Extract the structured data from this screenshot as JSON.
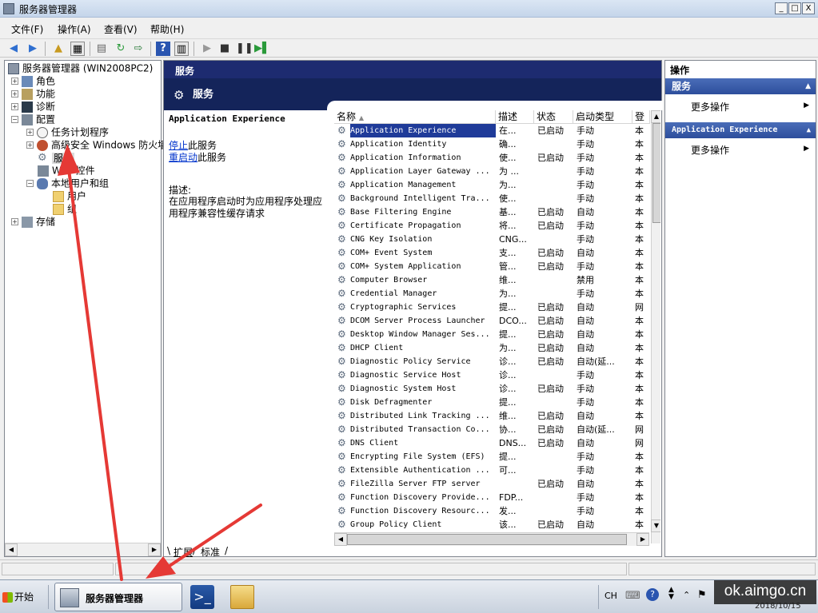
{
  "window": {
    "title": "服务器管理器",
    "controls": [
      "_",
      "□",
      "X"
    ]
  },
  "menu": [
    "文件(F)",
    "操作(A)",
    "查看(V)",
    "帮助(H)"
  ],
  "tree": {
    "root": "服务器管理器 (WIN2008PC2)",
    "roles": "角色",
    "features": "功能",
    "diagnostics": "诊断",
    "config": "配置",
    "task_scheduler": "任务计划程序",
    "firewall": "高级安全 Windows 防火墙",
    "services": "服务",
    "wmi": "WMI 控件",
    "local_users": "本地用户和组",
    "users": "用户",
    "groups": "组",
    "storage": "存储"
  },
  "center": {
    "header": "服务",
    "banner": "服务",
    "selected_service": "Application Experience",
    "stop_link": "停止",
    "stop_rest": "此服务",
    "restart_link": "重启动",
    "restart_rest": "此服务",
    "desc_label": "描述:",
    "desc_text": "在应用程序启动时为应用程序处理应用程序兼容性缓存请求",
    "tab_extended": "扩展",
    "tab_standard": "标准"
  },
  "list": {
    "columns": [
      "名称",
      "描述",
      "状态",
      "启动类型",
      "登"
    ],
    "rows": [
      [
        "Application Experience",
        "在...",
        "已启动",
        "手动",
        "本"
      ],
      [
        "Application Identity",
        "确...",
        "",
        "手动",
        "本"
      ],
      [
        "Application Information",
        "使...",
        "已启动",
        "手动",
        "本"
      ],
      [
        "Application Layer Gateway ...",
        "为 ...",
        "",
        "手动",
        "本"
      ],
      [
        "Application Management",
        "为...",
        "",
        "手动",
        "本"
      ],
      [
        "Background Intelligent Tra...",
        "使...",
        "",
        "手动",
        "本"
      ],
      [
        "Base Filtering Engine",
        "基...",
        "已启动",
        "自动",
        "本"
      ],
      [
        "Certificate Propagation",
        "将...",
        "已启动",
        "手动",
        "本"
      ],
      [
        "CNG Key Isolation",
        "CNG...",
        "",
        "手动",
        "本"
      ],
      [
        "COM+ Event System",
        "支...",
        "已启动",
        "自动",
        "本"
      ],
      [
        "COM+ System Application",
        "管...",
        "已启动",
        "手动",
        "本"
      ],
      [
        "Computer Browser",
        "维...",
        "",
        "禁用",
        "本"
      ],
      [
        "Credential Manager",
        "为...",
        "",
        "手动",
        "本"
      ],
      [
        "Cryptographic Services",
        "提...",
        "已启动",
        "自动",
        "网"
      ],
      [
        "DCOM Server Process Launcher",
        "DCO...",
        "已启动",
        "自动",
        "本"
      ],
      [
        "Desktop Window Manager Ses...",
        "提...",
        "已启动",
        "自动",
        "本"
      ],
      [
        "DHCP Client",
        "为...",
        "已启动",
        "自动",
        "本"
      ],
      [
        "Diagnostic Policy Service",
        "诊...",
        "已启动",
        "自动(延...",
        "本"
      ],
      [
        "Diagnostic Service Host",
        "诊...",
        "",
        "手动",
        "本"
      ],
      [
        "Diagnostic System Host",
        "诊...",
        "已启动",
        "手动",
        "本"
      ],
      [
        "Disk Defragmenter",
        "提...",
        "",
        "手动",
        "本"
      ],
      [
        "Distributed Link Tracking ...",
        "维...",
        "已启动",
        "自动",
        "本"
      ],
      [
        "Distributed Transaction Co...",
        "协...",
        "已启动",
        "自动(延...",
        "网"
      ],
      [
        "DNS Client",
        "DNS...",
        "已启动",
        "自动",
        "网"
      ],
      [
        "Encrypting File System (EFS)",
        "提...",
        "",
        "手动",
        "本"
      ],
      [
        "Extensible Authentication ...",
        "可...",
        "",
        "手动",
        "本"
      ],
      [
        "FileZilla Server FTP server",
        "",
        "已启动",
        "自动",
        "本"
      ],
      [
        "Function Discovery Provide...",
        "FDP...",
        "",
        "手动",
        "本"
      ],
      [
        "Function Discovery Resourc...",
        "发...",
        "",
        "手动",
        "本"
      ],
      [
        "Group Policy Client",
        "该...",
        "已启动",
        "自动",
        "本"
      ]
    ]
  },
  "actions": {
    "title": "操作",
    "section1": "服务",
    "section2": "Application Experience",
    "more1": "更多操作",
    "more2": "更多操作"
  },
  "taskbar": {
    "start": "开始",
    "app": "服务器管理器",
    "ime": "CH",
    "date": "2018/10/15"
  },
  "watermark": "ok.aimgo.cn",
  "colors": {
    "header_dark": "#1d2b70",
    "banner": "#14245a",
    "action_header": "#2d4e9c",
    "selection": "#1f3b99",
    "arrow": "#e53935"
  }
}
